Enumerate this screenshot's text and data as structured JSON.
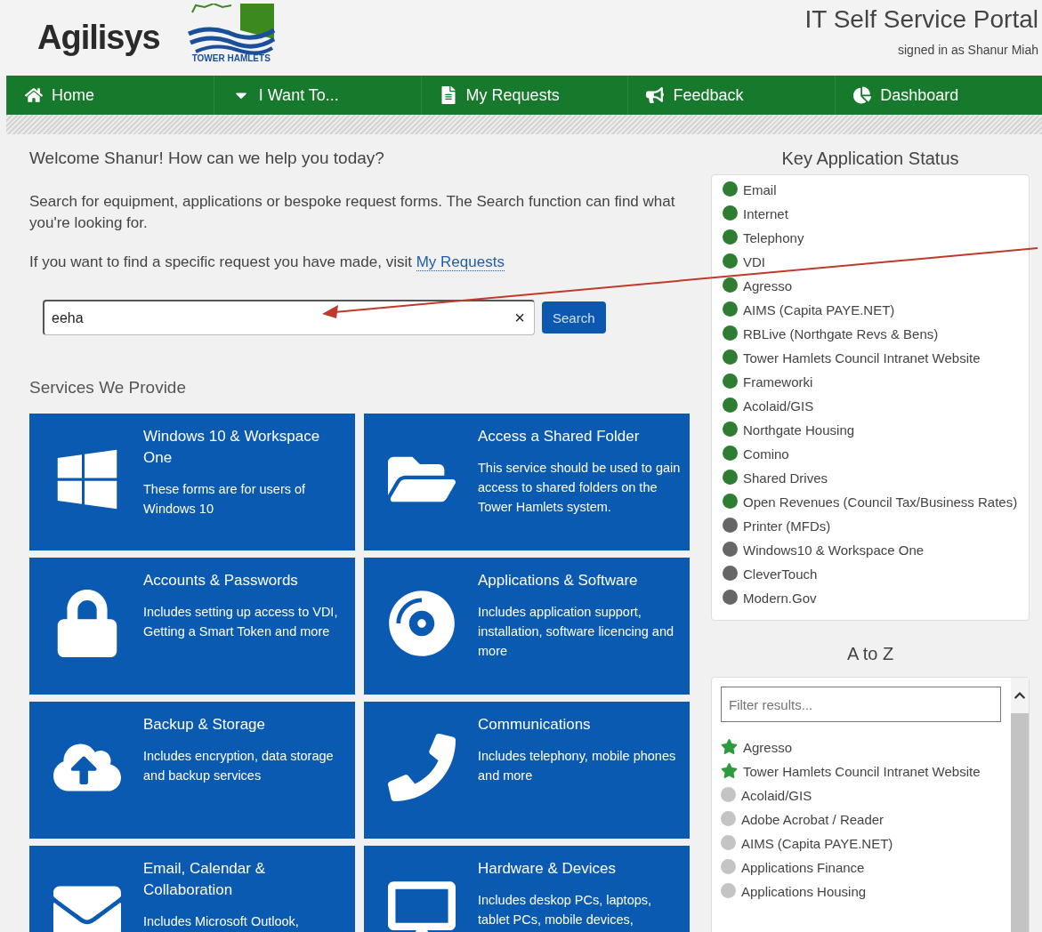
{
  "header": {
    "brand": "Agilisys",
    "council": "TOWER HAMLETS",
    "title": "IT Self Service Portal",
    "signed_in": "signed in as Shanur Miah"
  },
  "nav": [
    {
      "kind": "home",
      "label": "Home"
    },
    {
      "kind": "dropdown",
      "label": "I Want To..."
    },
    {
      "kind": "requests",
      "label": "My Requests"
    },
    {
      "kind": "feedback",
      "label": "Feedback"
    },
    {
      "kind": "dashboard",
      "label": "Dashboard"
    }
  ],
  "welcome": "Welcome Shanur! How can we help you today?",
  "intro": "Search for equipment, applications or bespoke request forms. The Search function can find what you're looking for.",
  "find_text": "If you want to find a specific request you have made, visit",
  "find_link": "My Requests",
  "search": {
    "value": "eeha",
    "clear": "×",
    "button": "Search"
  },
  "services_title": "Services We Provide",
  "services": [
    {
      "kind": "windows",
      "title": "Windows 10 & Workspace One",
      "text": "These forms are for users of Windows 10"
    },
    {
      "kind": "folder",
      "title": "Access a Shared Folder",
      "text": "This service should be used to gain access to shared folders on the Tower Hamlets system."
    },
    {
      "kind": "lock",
      "title": "Accounts & Passwords",
      "text": "Includes setting up access to VDI, Getting a Smart Token and more"
    },
    {
      "kind": "disc",
      "title": "Applications & Software",
      "text": "Includes application support, installation, software licencing and more"
    },
    {
      "kind": "cloud",
      "title": "Backup & Storage",
      "text": "Includes encryption, data storage and backup services"
    },
    {
      "kind": "phone",
      "title": "Communications",
      "text": "Includes telephony, mobile phones and more"
    },
    {
      "kind": "mail",
      "title": "Email, Calendar & Collaboration",
      "text": "Includes Microsoft Outlook,"
    },
    {
      "kind": "monitor",
      "title": "Hardware & Devices",
      "text": "Includes deskop PCs, laptops, tablet PCs, mobile devices,"
    }
  ],
  "status": {
    "title": "Key Application Status",
    "items": [
      {
        "name": "Email",
        "color": "#2e7d32"
      },
      {
        "name": "Internet",
        "color": "#2e7d32"
      },
      {
        "name": "Telephony",
        "color": "#2e7d32"
      },
      {
        "name": "VDI",
        "color": "#2e7d32"
      },
      {
        "name": "Agresso",
        "color": "#2e7d32"
      },
      {
        "name": "AIMS (Capita PAYE.NET)",
        "color": "#2e7d32"
      },
      {
        "name": "RBLive (Northgate Revs & Bens)",
        "color": "#2e7d32"
      },
      {
        "name": "Tower Hamlets Council Intranet Website",
        "color": "#2e7d32"
      },
      {
        "name": "Frameworki",
        "color": "#2e7d32"
      },
      {
        "name": "Acolaid/GIS",
        "color": "#2e7d32"
      },
      {
        "name": "Northgate Housing",
        "color": "#2e7d32"
      },
      {
        "name": "Comino",
        "color": "#2e7d32"
      },
      {
        "name": "Shared Drives",
        "color": "#2e7d32"
      },
      {
        "name": "Open Revenues (Council Tax/Business Rates)",
        "color": "#2e7d32"
      },
      {
        "name": "Printer (MFDs)",
        "color": "#666666"
      },
      {
        "name": "Windows10 & Workspace One",
        "color": "#666666"
      },
      {
        "name": "CleverTouch",
        "color": "#666666"
      },
      {
        "name": "Modern.Gov",
        "color": "#666666"
      }
    ]
  },
  "atoz": {
    "title": "A to Z",
    "placeholder": "Filter results...",
    "items": [
      {
        "name": "Agresso",
        "kind": "favourite"
      },
      {
        "name": "Tower Hamlets Council Intranet Website",
        "kind": "favourite"
      },
      {
        "name": "Acolaid/GIS",
        "kind": "app"
      },
      {
        "name": "Adobe Acrobat / Reader",
        "kind": "app"
      },
      {
        "name": "AIMS (Capita PAYE.NET)",
        "kind": "app"
      },
      {
        "name": "Applications Finance",
        "kind": "app"
      },
      {
        "name": "Applications Housing",
        "kind": "app"
      }
    ]
  }
}
